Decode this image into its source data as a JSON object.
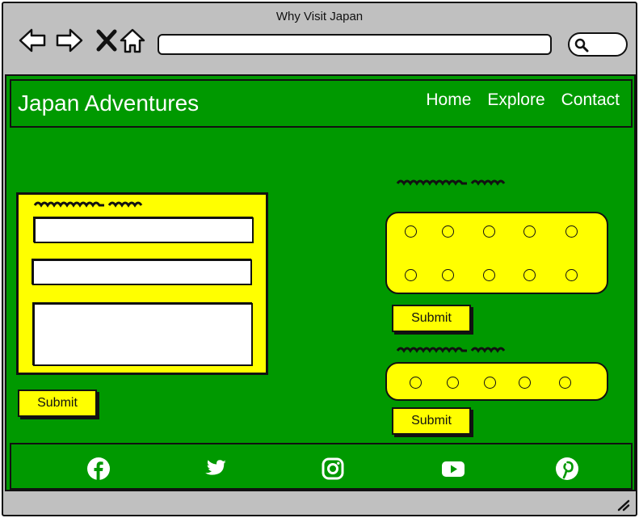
{
  "browser": {
    "title": "Why Visit Japan"
  },
  "header": {
    "site_title": "Japan Adventures",
    "nav": [
      "Home",
      "Explore",
      "Contact"
    ]
  },
  "contact_form": {
    "submit_label": "Submit"
  },
  "survey_a": {
    "submit_label": "Submit"
  },
  "survey_b": {
    "submit_label": "Submit"
  },
  "footer": {
    "icons": [
      "facebook-icon",
      "twitter-icon",
      "instagram-icon",
      "youtube-icon",
      "pinterest-icon"
    ]
  },
  "colors": {
    "page_green": "#009900",
    "panel_yellow": "#ffff00",
    "chrome_gray": "#c0c0c0"
  }
}
